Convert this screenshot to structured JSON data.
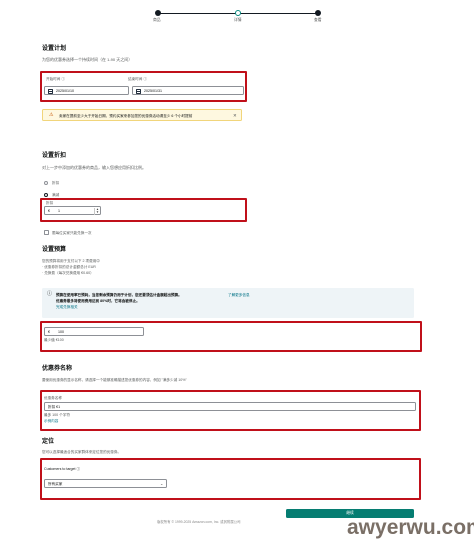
{
  "stepper": {
    "steps": [
      "商品",
      "详情",
      "查看"
    ]
  },
  "schedule": {
    "title": "设置计划",
    "subtitle": "为您的优惠券选择一个持续时间（在 1-90 天之间）",
    "start_label": "开始时间 ⓘ",
    "start_value": "2025/01/10",
    "end_label": "结束时间 ⓘ",
    "end_value": "2025/01/31",
    "warning": "卖家在提前至少大于开始日期，预约买家来参加您的优惠券活动请至少 6 个小时提前"
  },
  "discount": {
    "title": "设置折扣",
    "subtitle": "对上一步中添加的优惠券的商品，输入您想应用折扣比例。",
    "option_percent": "折扣",
    "option_amount": "满减",
    "field_label": "折扣",
    "currency": "€",
    "value": "1",
    "once_label": "限每位买家只能兑换一次"
  },
  "budget": {
    "title": "设置预算",
    "desc_1": "您的预算将用于支付以下 2 项费用中",
    "desc_2": "· 优惠券折扣的总计金额总计 EUR",
    "desc_3": "· 兑换费（每次兑换费用 €0.60）",
    "info_bold": "预算在使用率已预耗，当您剩余预算仍用于计划，您还要须估计金额超出预算。",
    "info_link": "了解更多信息",
    "info_line2": "优惠券最多将使用费用达到 80%时，它将会被停止。",
    "info_line3": "完成兑换相关",
    "currency": "€",
    "value": "100",
    "min_note": "最少值 €100"
  },
  "name": {
    "title": "优惠券名称",
    "desc": "要使用优惠券的显示名称，请选择一个能够准确描述您优惠券的内容，例如 \"满多少减 10%\"",
    "field_label": "优惠券名称",
    "value": "折扣 €1",
    "counter": "最多 100 个字符",
    "link": "示例内容"
  },
  "target": {
    "title": "定位",
    "desc": "您可以选择最适合的买家群体来定位您的优惠券。",
    "field_label": "Customers to target ⓘ",
    "value": "所有买家"
  },
  "footer": {
    "copyright": "版权所有 © 1999-2025 Amazon.com, Inc. 或其附属公司",
    "submit_label": "继续",
    "watermark": "awyerwu.com"
  },
  "colors": {
    "highlight": "#c0101a",
    "primary": "#067d72",
    "warning_bg": "#fef8e0"
  }
}
